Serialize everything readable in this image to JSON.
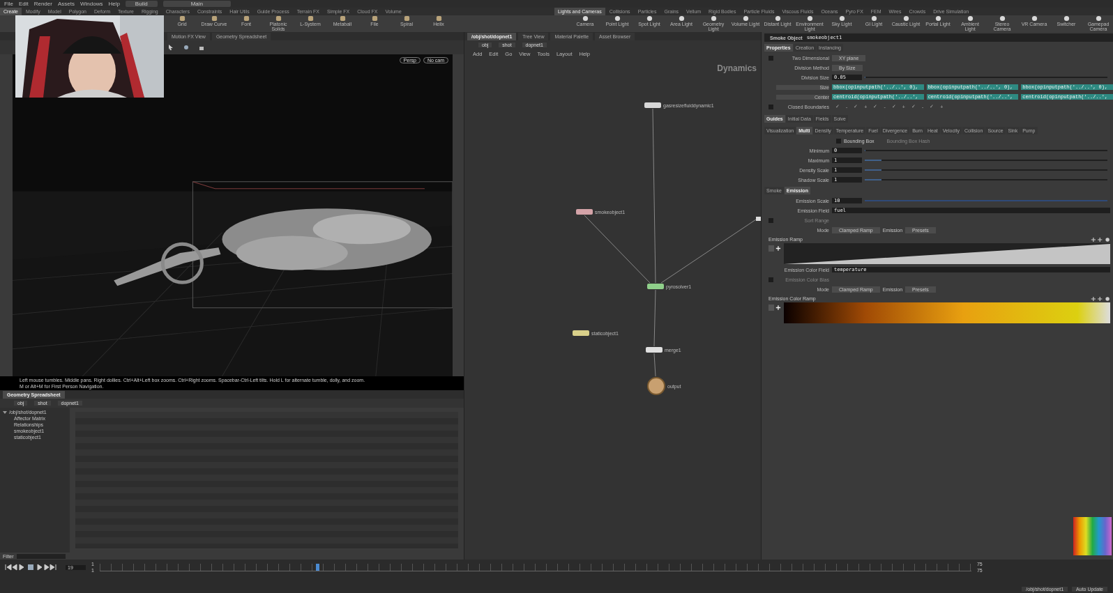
{
  "menubar": {
    "items": [
      "File",
      "Edit",
      "Render",
      "Assets",
      "Windows",
      "Help"
    ],
    "desktop": "Build",
    "context": "Main"
  },
  "shelf_tabs_left": [
    {
      "label": "Create",
      "selected": true
    },
    {
      "label": "Modify",
      "selected": false
    },
    {
      "label": "Model",
      "selected": false
    },
    {
      "label": "Polygon",
      "selected": false
    },
    {
      "label": "Deform",
      "selected": false
    },
    {
      "label": "Texture",
      "selected": false
    },
    {
      "label": "Rigging",
      "selected": false
    },
    {
      "label": "Characters",
      "selected": false
    },
    {
      "label": "Constraints",
      "selected": false
    },
    {
      "label": "Hair Utils",
      "selected": false
    },
    {
      "label": "Guide Process",
      "selected": false
    },
    {
      "label": "Terrain FX",
      "selected": false
    },
    {
      "label": "Simple FX",
      "selected": false
    },
    {
      "label": "Cloud FX",
      "selected": false
    },
    {
      "label": "Volume",
      "selected": false
    }
  ],
  "shelf_tabs_right": [
    {
      "label": "Lights and Cameras",
      "selected": true
    },
    {
      "label": "Collisions",
      "selected": false
    },
    {
      "label": "Particles",
      "selected": false
    },
    {
      "label": "Grains",
      "selected": false
    },
    {
      "label": "Vellum",
      "selected": false
    },
    {
      "label": "Rigid Bodies",
      "selected": false
    },
    {
      "label": "Particle Fluids",
      "selected": false
    },
    {
      "label": "Viscous Fluids",
      "selected": false
    },
    {
      "label": "Oceans",
      "selected": false
    },
    {
      "label": "Pyro FX",
      "selected": false
    },
    {
      "label": "FEM",
      "selected": false
    },
    {
      "label": "Wires",
      "selected": false
    },
    {
      "label": "Crowds",
      "selected": false
    },
    {
      "label": "Drive Simulation",
      "selected": false
    }
  ],
  "shelf_tools_left": [
    "Grid",
    "Draw Curve",
    "Font",
    "Platonic Solids",
    "L-System",
    "Metaball",
    "File",
    "Spiral",
    "Helix"
  ],
  "shelf_tools_right": [
    "Camera",
    "Point Light",
    "Spot Light",
    "Area Light",
    "Geometry Light",
    "Volume Light",
    "Distant Light",
    "Environment Light",
    "Sky Light",
    "GI Light",
    "Caustic Light",
    "Portal Light",
    "Ambient Light",
    "Stereo Camera",
    "VR Camera",
    "Switcher",
    "Gamepad Camera"
  ],
  "viewer": {
    "tabs": [
      {
        "label": "Motion FX View",
        "selected": false
      },
      {
        "label": "Geometry Spreadsheet",
        "selected": false
      }
    ],
    "camera_buttons": [
      "Persp",
      "No cam"
    ],
    "status": "Left mouse tumbles. Middle pans. Right dollies. Ctrl+Alt+Left box zooms. Ctrl+Right zooms. Spacebar-Ctrl-Left tilts. Hold L for alternate tumble, dolly, and zoom.",
    "status_hint": "M or Alt+M for First Person Navigation."
  },
  "spreadsheet": {
    "tab": "Geometry Spreadsheet",
    "path": [
      "obj",
      "shot"
    ],
    "node": "dopnet1",
    "tree": {
      "label": "/obj/shot/dopnet1",
      "expanded": true,
      "children": [
        {
          "label": "Affector Matrix"
        },
        {
          "label": "Relationships"
        },
        {
          "label": "smokeobject1"
        },
        {
          "label": "staticobject1"
        }
      ]
    },
    "filter": "Filter"
  },
  "network": {
    "tabs": [
      {
        "label": "/obj/shot/dopnet1",
        "selected": true
      },
      {
        "label": "Tree View",
        "selected": false
      },
      {
        "label": "Material Palette",
        "selected": false
      },
      {
        "label": "Asset Browser",
        "selected": false
      }
    ],
    "path": [
      "obj",
      "shot",
      "dopnet1"
    ],
    "menu": [
      "Add",
      "Edit",
      "Go",
      "View",
      "Tools",
      "Layout",
      "Help"
    ],
    "context_label": "Dynamics",
    "nodes": [
      {
        "name": "gasresizefluiddynamic1",
        "color": "#d8d8d8",
        "kind": "box"
      },
      {
        "name": "smokeobject1",
        "color": "#d4a3a8",
        "kind": "box"
      },
      {
        "name": "pyrosolver1",
        "color": "#8fcf8a",
        "kind": "box"
      },
      {
        "name": "staticobject1",
        "color": "#d9d08a",
        "kind": "box"
      },
      {
        "name": "merge1",
        "color": "#e0e0e0",
        "kind": "box"
      },
      {
        "name": "output",
        "color": "#c8a070",
        "kind": "output"
      }
    ]
  },
  "params": {
    "type": "Smoke Object",
    "name": "smokeobject1",
    "tabs": [
      {
        "label": "Properties",
        "selected": true
      },
      {
        "label": "Creation",
        "selected": false
      },
      {
        "label": "Instancing",
        "selected": false
      }
    ],
    "rows": [
      {
        "kind": "toggle_menu",
        "label": "Two Dimensional",
        "checked": false,
        "value": "XY plane"
      },
      {
        "kind": "menu",
        "label": "Division Method",
        "value": "By Size"
      },
      {
        "kind": "slider",
        "label": "Division Size",
        "value": "0.05",
        "level": 0
      },
      {
        "kind": "expr",
        "label": "Size",
        "values": [
          "bbox(opinputpath('../..', 0),",
          "bbox(opinputpath('../..', 0),",
          "bbox(opinputpath('../..', 0),"
        ]
      },
      {
        "kind": "expr",
        "label": "Center",
        "values": [
          "centroid(opinputpath('../..',",
          "centroid(opinputpath('../..',",
          "centroid(opinputpath('../..',"
        ]
      },
      {
        "kind": "toggle",
        "label": "Closed Boundaries",
        "checked": false,
        "marks": [
          "✓",
          "-",
          "✓",
          "+",
          "✓",
          "-",
          "✓",
          "+",
          "✓",
          "-",
          "✓",
          "+"
        ]
      }
    ],
    "section_tabs": [
      {
        "label": "Guides",
        "selected": true
      },
      {
        "label": "Initial Data",
        "selected": false
      },
      {
        "label": "Fields",
        "selected": false
      },
      {
        "label": "Solve",
        "selected": false
      }
    ],
    "sub_tabs": [
      {
        "label": "Visualization",
        "selected": false
      },
      {
        "label": "Multi",
        "selected": true
      },
      {
        "label": "Density",
        "selected": false
      },
      {
        "label": "Temperature",
        "selected": false
      },
      {
        "label": "Fuel",
        "selected": false
      },
      {
        "label": "Divergence",
        "selected": false
      },
      {
        "label": "Burn",
        "selected": false
      },
      {
        "label": "Heat",
        "selected": false
      },
      {
        "label": "Velocity",
        "selected": false
      },
      {
        "label": "Collision",
        "selected": false
      },
      {
        "label": "Source",
        "selected": false
      },
      {
        "label": "Sink",
        "selected": false
      },
      {
        "label": "Pump",
        "selected": false
      }
    ],
    "guide_rows": [
      {
        "kind": "toggle_pair",
        "label": "Bounding Box",
        "checked": false,
        "other": "Bounding Box Hash",
        "other_disabled": true
      },
      {
        "kind": "slider",
        "label": "Minimum",
        "value": "0",
        "level": 0
      },
      {
        "kind": "slider",
        "label": "Maximum",
        "value": "1",
        "level": 0.07
      },
      {
        "kind": "slider",
        "label": "Density Scale",
        "value": "1",
        "level": 0.07
      },
      {
        "kind": "slider",
        "label": "Shadow Scale",
        "value": "1",
        "level": 0.07
      }
    ],
    "inner_tabs": [
      {
        "label": "Smoke",
        "selected": false
      },
      {
        "label": "Emission",
        "selected": true
      }
    ],
    "emission_rows": [
      {
        "kind": "slider",
        "label": "Emission Scale",
        "value": "10",
        "level": 1
      },
      {
        "kind": "string",
        "label": "Emission Field",
        "value": "fuel"
      },
      {
        "kind": "toggle",
        "label": "Sort Range",
        "checked": false,
        "disabled": true
      },
      {
        "kind": "mode",
        "label": "Mode",
        "value": "Clamped Ramp",
        "label2": "Emission",
        "value2": "Presets"
      },
      {
        "kind": "ramp_float",
        "label": "Emission Ramp"
      },
      {
        "kind": "string",
        "label": "Emission Color Field",
        "value": "temperature"
      },
      {
        "kind": "toggle",
        "label": "Emission Color Bias",
        "checked": false,
        "disabled": true
      },
      {
        "kind": "mode",
        "label": "Mode",
        "value": "Clamped Ramp",
        "label2": "Emission",
        "value2": "Presets"
      },
      {
        "kind": "ramp_color",
        "label": "Emission Color Ramp"
      }
    ]
  },
  "timeline": {
    "frame": "19",
    "start": "1",
    "start2": "1",
    "end": "75",
    "end2": "75",
    "level": 0.25
  },
  "status_bar": {
    "path": "/obj/shot/dopnet1",
    "update": "Auto Update"
  }
}
